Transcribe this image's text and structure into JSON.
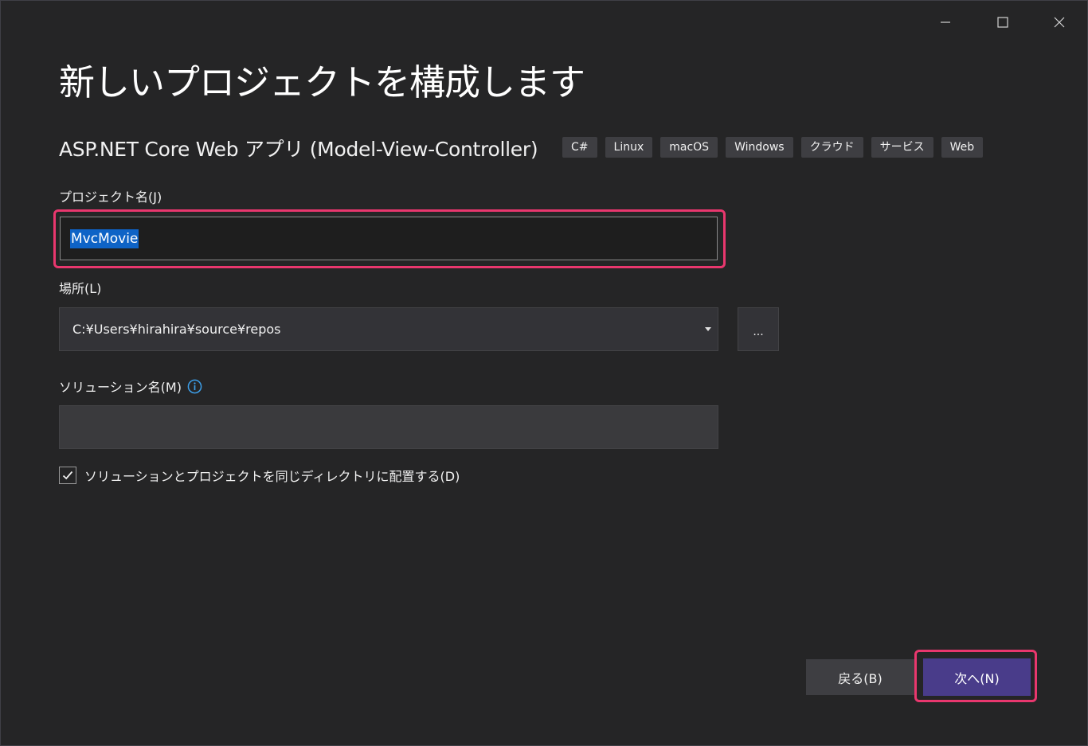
{
  "window": {
    "controls": {
      "minimize_icon": "minimize-icon",
      "maximize_icon": "maximize-icon",
      "close_icon": "close-icon"
    }
  },
  "header": {
    "title": "新しいプロジェクトを構成します",
    "template_name": "ASP.NET Core Web アプリ (Model-View-Controller)",
    "tags": [
      "C#",
      "Linux",
      "macOS",
      "Windows",
      "クラウド",
      "サービス",
      "Web"
    ]
  },
  "form": {
    "project_name": {
      "label": "プロジェクト名(J)",
      "value": "MvcMovie"
    },
    "location": {
      "label": "場所(L)",
      "value": "C:¥Users¥hirahira¥source¥repos",
      "browse_label": "..."
    },
    "solution_name": {
      "label": "ソリューション名(M)",
      "value": "",
      "info_icon": "info-icon"
    },
    "same_directory": {
      "label": "ソリューションとプロジェクトを同じディレクトリに配置する(D)",
      "checked": true
    }
  },
  "footer": {
    "back_label": "戻る(B)",
    "next_label": "次へ(N)"
  },
  "colors": {
    "background": "#252526",
    "accent_button": "#493c8a",
    "highlight": "#e9376e",
    "selection": "#0e63c6",
    "info": "#3c9ee8"
  }
}
